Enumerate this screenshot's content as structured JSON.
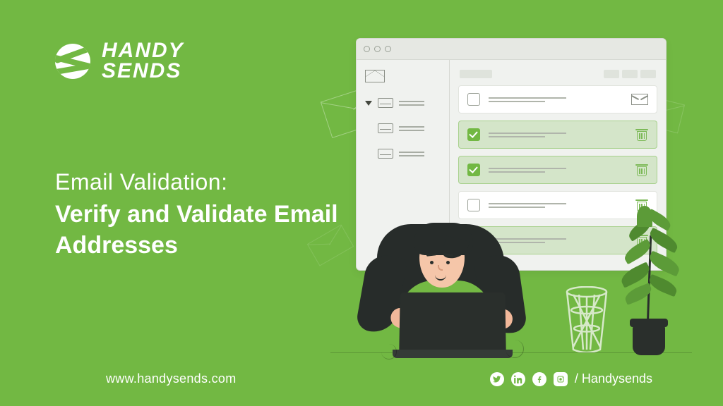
{
  "brand": {
    "line1": "HANDY",
    "line2": "SENDS"
  },
  "headline": {
    "line1": "Email Validation:",
    "line2": "Verify and Validate Email Addresses"
  },
  "footer": {
    "url": "www.handysends.com",
    "handle": "/ Handysends"
  },
  "mock": {
    "rows": [
      {
        "checked": false,
        "action": "envelope"
      },
      {
        "checked": true,
        "action": "trash"
      },
      {
        "checked": true,
        "action": "trash"
      },
      {
        "checked": false,
        "action": "trash"
      },
      {
        "checked": true,
        "action": "trash"
      }
    ]
  }
}
